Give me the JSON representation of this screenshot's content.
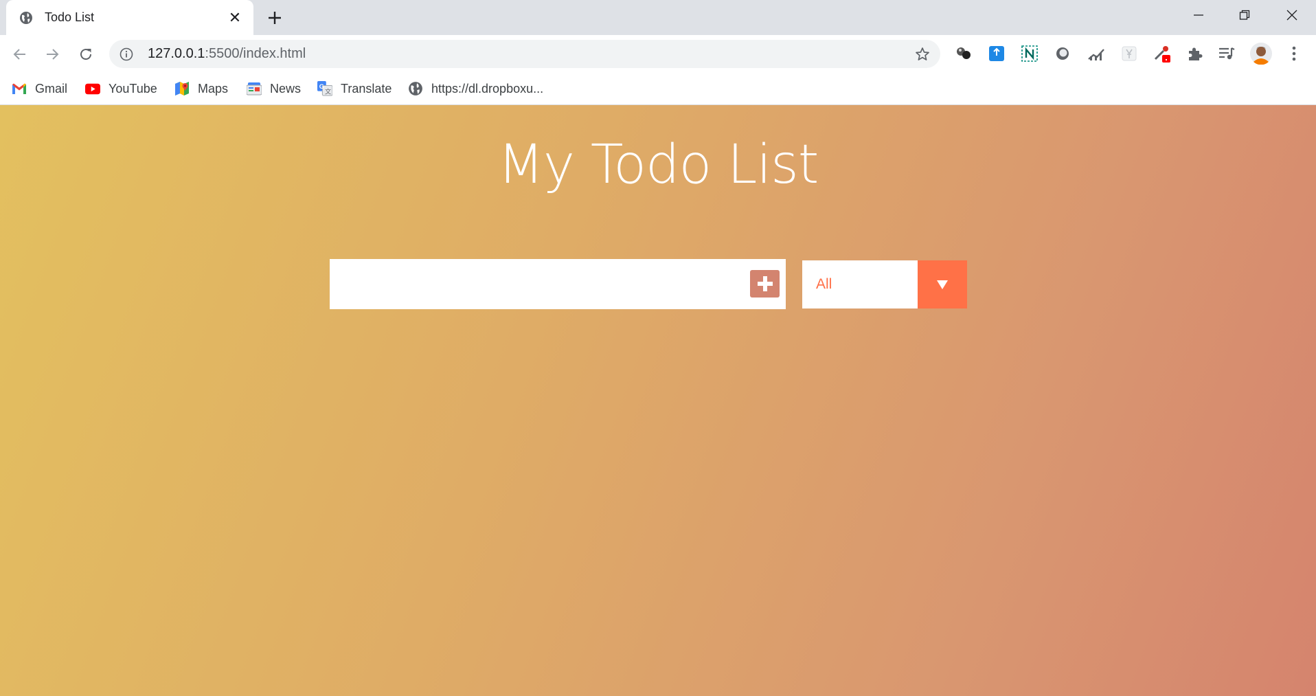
{
  "browser": {
    "tab": {
      "title": "Todo List"
    },
    "address": {
      "host": "127.0.0.1",
      "path": ":5500/index.html"
    },
    "bookmarks": [
      {
        "label": "Gmail",
        "icon": "gmail-icon"
      },
      {
        "label": "YouTube",
        "icon": "youtube-icon"
      },
      {
        "label": "Maps",
        "icon": "maps-icon"
      },
      {
        "label": "News",
        "icon": "news-icon"
      },
      {
        "label": "Translate",
        "icon": "translate-icon"
      },
      {
        "label": "https://dl.dropboxu...",
        "icon": "globe-icon"
      }
    ]
  },
  "page": {
    "title": "My Todo List",
    "todo_input": {
      "value": "",
      "placeholder": ""
    },
    "filter": {
      "selected": "All"
    }
  },
  "colors": {
    "gradient_start": "#e3c05f",
    "gradient_end": "#d5846e",
    "add_button": "#d3846f",
    "filter_accent": "#ff7147"
  }
}
